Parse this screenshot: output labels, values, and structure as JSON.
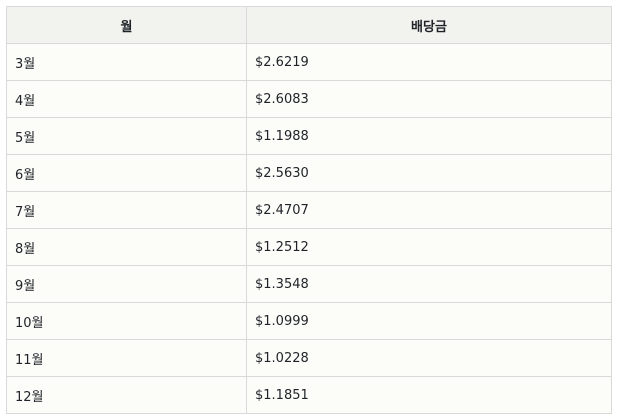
{
  "table": {
    "headers": [
      "월",
      "배당금"
    ],
    "rows": [
      [
        "3월",
        "$2.6219"
      ],
      [
        "4월",
        "$2.6083"
      ],
      [
        "5월",
        "$1.1988"
      ],
      [
        "6월",
        "$2.5630"
      ],
      [
        "7월",
        "$2.4707"
      ],
      [
        "8월",
        "$1.2512"
      ],
      [
        "9월",
        "$1.3548"
      ],
      [
        "10월",
        "$1.0999"
      ],
      [
        "11월",
        "$1.0228"
      ],
      [
        "12월",
        "$1.1851"
      ]
    ]
  }
}
